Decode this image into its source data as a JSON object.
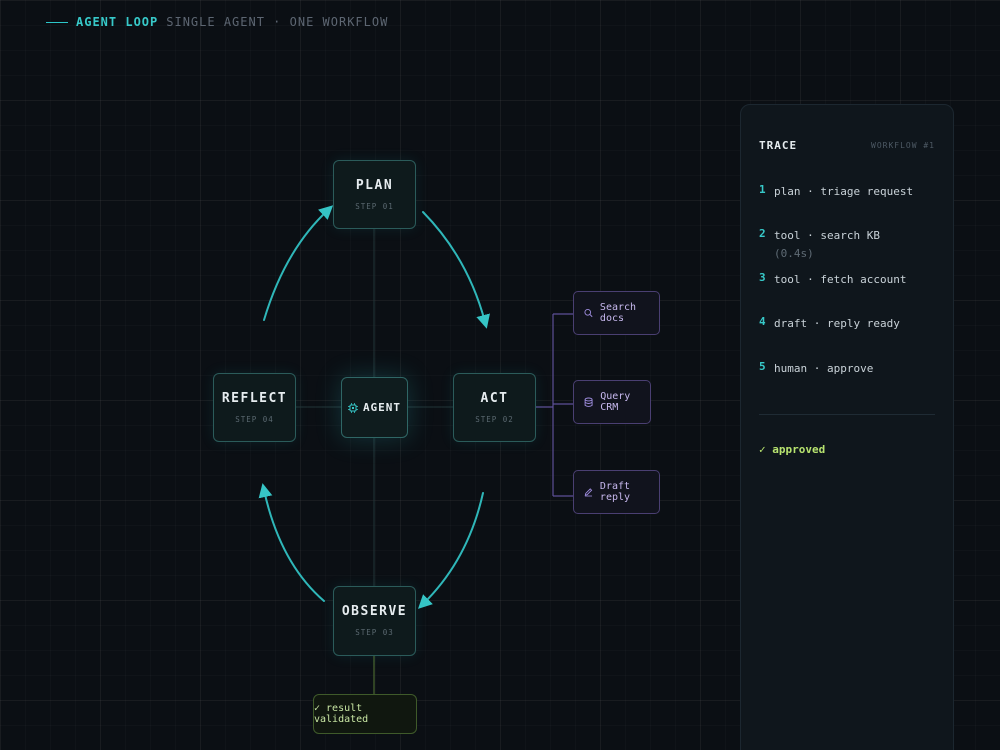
{
  "header": {
    "title": "AGENT LOOP",
    "subtitle": "SINGLE AGENT · ONE WORKFLOW"
  },
  "diagram": {
    "agent_label": "AGENT",
    "nodes": {
      "plan": {
        "title": "PLAN",
        "step": "STEP 01"
      },
      "act": {
        "title": "ACT",
        "step": "STEP 02"
      },
      "observe": {
        "title": "OBSERVE",
        "step": "STEP 03"
      },
      "reflect": {
        "title": "REFLECT",
        "step": "STEP 04"
      }
    },
    "tools": [
      {
        "label": "Search docs",
        "icon": "search-icon"
      },
      {
        "label": "Query CRM",
        "icon": "database-icon"
      },
      {
        "label": "Draft reply",
        "icon": "pencil-icon"
      }
    ],
    "result": "✓ result validated"
  },
  "trace": {
    "title": "TRACE",
    "tag": "WORKFLOW #1",
    "items": [
      {
        "num": "1",
        "text": "plan · triage request",
        "sub": ""
      },
      {
        "num": "2",
        "text": "tool · search KB",
        "sub": "(0.4s)"
      },
      {
        "num": "3",
        "text": "tool · fetch account",
        "sub": ""
      },
      {
        "num": "4",
        "text": "draft · reply ready",
        "sub": ""
      },
      {
        "num": "5",
        "text": "human · approve",
        "sub": ""
      }
    ],
    "status": "✓ approved"
  },
  "colors": {
    "accent": "#2cc6c9",
    "tool_accent": "#7d68c4",
    "success": "#b7e36f",
    "background": "#0b0f14"
  }
}
